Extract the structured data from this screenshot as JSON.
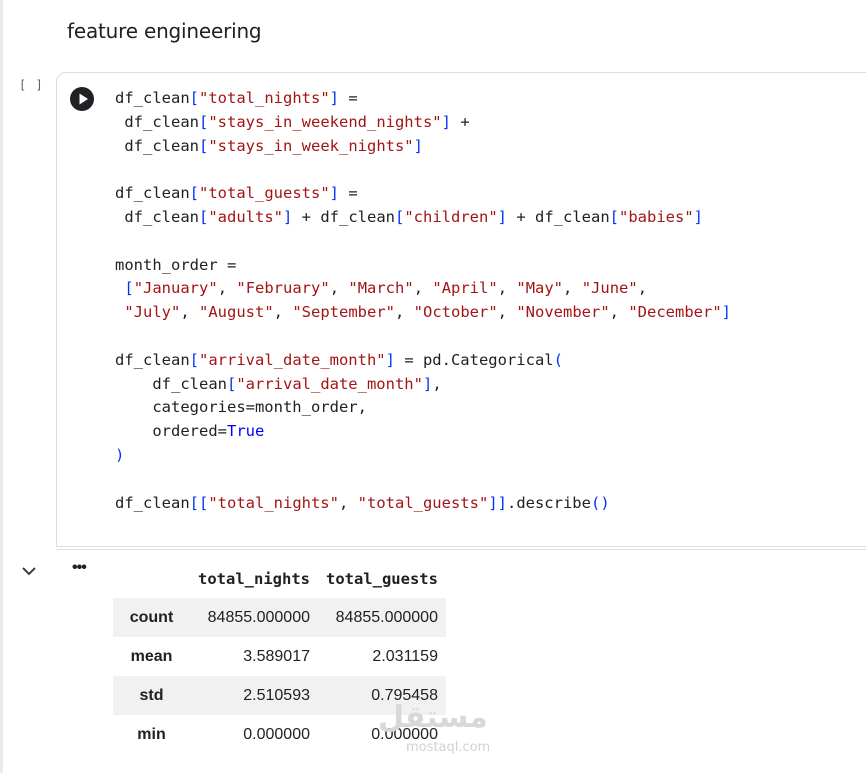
{
  "section": {
    "title": "feature engineering"
  },
  "cell": {
    "exec_count": "[ ]",
    "code_lines": [
      [
        [
          "t",
          "df_clean"
        ],
        [
          "b",
          "["
        ],
        [
          "s",
          "\"total_nights\""
        ],
        [
          "b",
          "]"
        ],
        [
          "t",
          " ="
        ]
      ],
      [
        [
          "t",
          " df_clean"
        ],
        [
          "b",
          "["
        ],
        [
          "s",
          "\"stays_in_weekend_nights\""
        ],
        [
          "b",
          "]"
        ],
        [
          "t",
          " +"
        ]
      ],
      [
        [
          "t",
          " df_clean"
        ],
        [
          "b",
          "["
        ],
        [
          "s",
          "\"stays_in_week_nights\""
        ],
        [
          "b",
          "]"
        ]
      ],
      [],
      [
        [
          "t",
          "df_clean"
        ],
        [
          "b",
          "["
        ],
        [
          "s",
          "\"total_guests\""
        ],
        [
          "b",
          "]"
        ],
        [
          "t",
          " ="
        ]
      ],
      [
        [
          "t",
          " df_clean"
        ],
        [
          "b",
          "["
        ],
        [
          "s",
          "\"adults\""
        ],
        [
          "b",
          "]"
        ],
        [
          "t",
          " + df_clean"
        ],
        [
          "b",
          "["
        ],
        [
          "s",
          "\"children\""
        ],
        [
          "b",
          "]"
        ],
        [
          "t",
          " + df_clean"
        ],
        [
          "b",
          "["
        ],
        [
          "s",
          "\"babies\""
        ],
        [
          "b",
          "]"
        ]
      ],
      [],
      [
        [
          "t",
          "month_order ="
        ]
      ],
      [
        [
          "t",
          " "
        ],
        [
          "b",
          "["
        ],
        [
          "s",
          "\"January\""
        ],
        [
          "t",
          ", "
        ],
        [
          "s",
          "\"February\""
        ],
        [
          "t",
          ", "
        ],
        [
          "s",
          "\"March\""
        ],
        [
          "t",
          ", "
        ],
        [
          "s",
          "\"April\""
        ],
        [
          "t",
          ", "
        ],
        [
          "s",
          "\"May\""
        ],
        [
          "t",
          ", "
        ],
        [
          "s",
          "\"June\""
        ],
        [
          "t",
          ","
        ]
      ],
      [
        [
          "t",
          " "
        ],
        [
          "s",
          "\"July\""
        ],
        [
          "t",
          ", "
        ],
        [
          "s",
          "\"August\""
        ],
        [
          "t",
          ", "
        ],
        [
          "s",
          "\"September\""
        ],
        [
          "t",
          ", "
        ],
        [
          "s",
          "\"October\""
        ],
        [
          "t",
          ", "
        ],
        [
          "s",
          "\"November\""
        ],
        [
          "t",
          ", "
        ],
        [
          "s",
          "\"December\""
        ],
        [
          "b",
          "]"
        ]
      ],
      [],
      [
        [
          "t",
          "df_clean"
        ],
        [
          "b",
          "["
        ],
        [
          "s",
          "\"arrival_date_month\""
        ],
        [
          "b",
          "]"
        ],
        [
          "t",
          " = pd.Categorical"
        ],
        [
          "b",
          "("
        ]
      ],
      [
        [
          "t",
          "    df_clean"
        ],
        [
          "b",
          "["
        ],
        [
          "s",
          "\"arrival_date_month\""
        ],
        [
          "b",
          "]"
        ],
        [
          "t",
          ","
        ]
      ],
      [
        [
          "t",
          "    categories=month_order,"
        ]
      ],
      [
        [
          "t",
          "    ordered="
        ],
        [
          "k",
          "True"
        ]
      ],
      [
        [
          "b",
          ")"
        ]
      ],
      [],
      [
        [
          "t",
          "df_clean"
        ],
        [
          "b",
          "[["
        ],
        [
          "s",
          "\"total_nights\""
        ],
        [
          "t",
          ", "
        ],
        [
          "s",
          "\"total_guests\""
        ],
        [
          "b",
          "]]"
        ],
        [
          "t",
          ".describe"
        ],
        [
          "b",
          "()"
        ]
      ]
    ]
  },
  "output": {
    "more_label": "•••",
    "columns": [
      "total_nights",
      "total_guests"
    ],
    "rows": [
      {
        "label": "count",
        "values": [
          "84855.000000",
          "84855.000000"
        ]
      },
      {
        "label": "mean",
        "values": [
          "3.589017",
          "2.031159"
        ]
      },
      {
        "label": "std",
        "values": [
          "2.510593",
          "0.795458"
        ]
      },
      {
        "label": "min",
        "values": [
          "0.000000",
          "0.000000"
        ]
      }
    ]
  },
  "watermark": {
    "brand": "مستقل",
    "domain": "mostaql.com"
  },
  "colors": {
    "string": "#a31515",
    "bracket": "#0431fa",
    "keyword": "#0000ff",
    "run_button": "#202124"
  }
}
